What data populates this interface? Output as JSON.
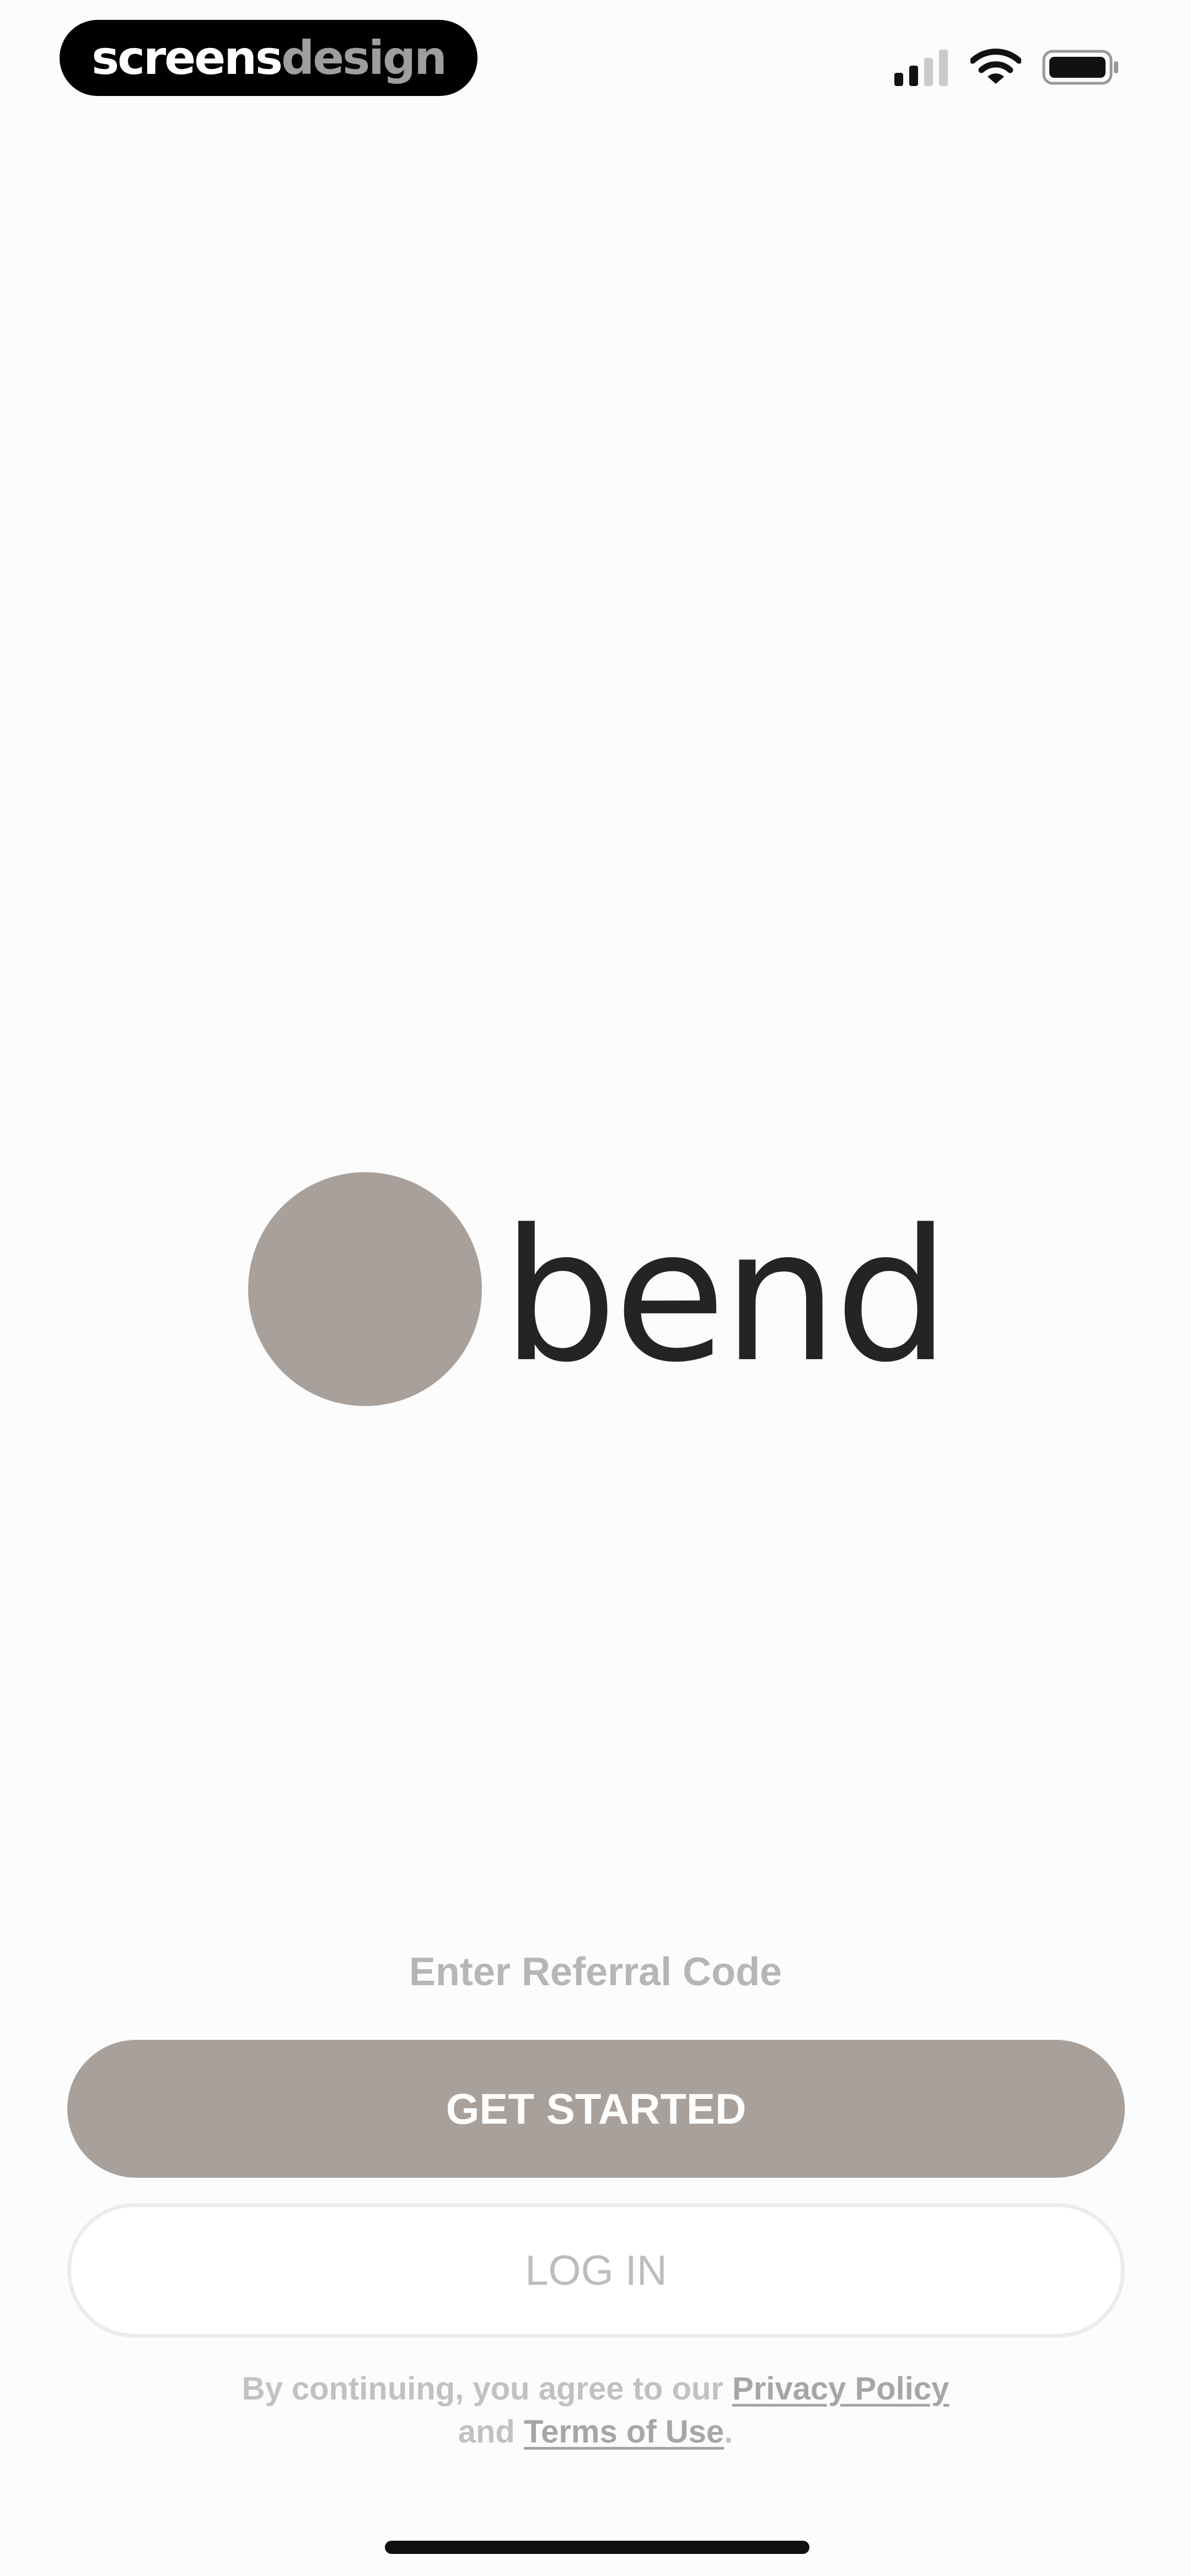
{
  "status_bar": {
    "watermark_part1": "screens",
    "watermark_part2": "design",
    "signal_icon": "cellular-signal-icon",
    "wifi_icon": "wifi-icon",
    "battery_icon": "battery-icon"
  },
  "logo": {
    "wordmark": "bend",
    "mark_color": "#a8a09b"
  },
  "actions": {
    "referral_link": "Enter Referral Code",
    "get_started_label": "GET STARTED",
    "log_in_label": "LOG IN"
  },
  "legal": {
    "prefix": "By continuing, you agree to our",
    "privacy_policy": "Privacy Policy",
    "conjunction": "and",
    "terms_of_use": "Terms of Use",
    "suffix": "."
  },
  "colors": {
    "accent": "#a8a09b",
    "wordmark": "#252324",
    "background": "#fcfcfc"
  }
}
